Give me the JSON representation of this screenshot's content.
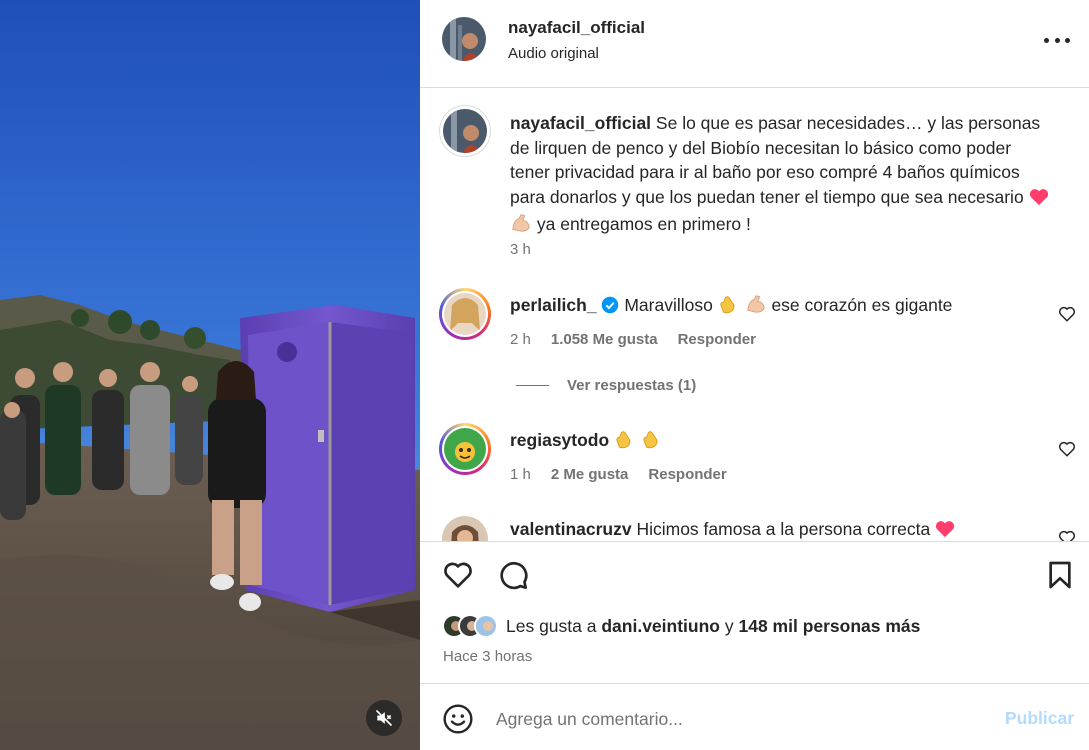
{
  "post": {
    "username": "nayafacil_official",
    "audio": "Audio original",
    "caption_username": "nayafacil_official",
    "caption": "Se lo que es pasar necesidades… y las personas de lirquen de penco y del Biobío necesitan lo básico como poder tener privacidad para ir al baño por eso compré 4 baños químicos para donarlos y que los puedan tener el tiempo que sea necesario",
    "caption_tail": "ya entregamos en primero !",
    "caption_time": "3 h"
  },
  "comments": [
    {
      "username": "perlailich_",
      "verified": true,
      "text_a": "Maravilloso",
      "text_b": "ese corazón es gigante",
      "time": "2 h",
      "likes": "1.058 Me gusta",
      "reply": "Responder"
    },
    {
      "username": "regiasytodo",
      "time": "1 h",
      "likes": "2 Me gusta",
      "reply": "Responder"
    },
    {
      "username": "valentinacruzv",
      "text": "Hicimos famosa a la persona correcta"
    }
  ],
  "view_replies": "Ver respuestas (1)",
  "likes": {
    "prefix": "Les gusta a",
    "user": "dani.veintiuno",
    "connector": "y",
    "others": "148 mil personas más"
  },
  "post_time": "Hace 3 horas",
  "comment_box": {
    "placeholder": "Agrega un comentario...",
    "publish": "Publicar"
  },
  "colors": {
    "accent": "#0095f6",
    "publish_disabled": "#b3dbff",
    "heart_red": "#ff3040",
    "verified_blue": "#0095f6",
    "toilet_purple": "#6a4fc4",
    "sky_blue": "#2a62c9"
  },
  "icons": {
    "more": "more-horizontal-icon",
    "like": "heart-icon",
    "comment": "comment-bubble-icon",
    "save": "bookmark-icon",
    "emoji": "smiley-icon",
    "mute": "speaker-muted-icon"
  }
}
